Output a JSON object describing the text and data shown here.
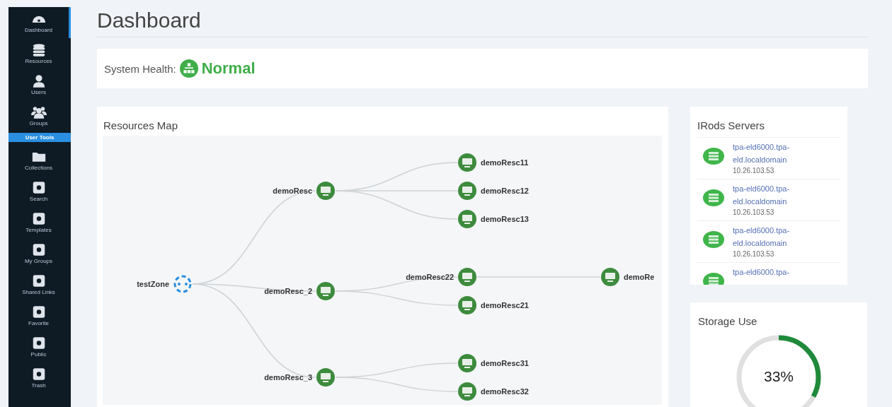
{
  "sidebar": {
    "items": [
      {
        "kind": "item",
        "label": "Dashboard",
        "selected": true
      },
      {
        "kind": "item",
        "label": "Resources",
        "selected": false
      },
      {
        "kind": "item",
        "label": "Users",
        "selected": false
      },
      {
        "kind": "item",
        "label": "Groups",
        "selected": false
      },
      {
        "kind": "section",
        "label": "User Tools"
      },
      {
        "kind": "item",
        "label": "Collections",
        "selected": false
      },
      {
        "kind": "item",
        "label": "Search",
        "selected": false
      },
      {
        "kind": "item",
        "label": "Templates",
        "selected": false
      },
      {
        "kind": "item",
        "label": "My Groups",
        "selected": false
      },
      {
        "kind": "item",
        "label": "Shared Links",
        "selected": false
      },
      {
        "kind": "item",
        "label": "Favorite",
        "selected": false
      },
      {
        "kind": "item",
        "label": "Public",
        "selected": false
      },
      {
        "kind": "item",
        "label": "Trash",
        "selected": false
      }
    ]
  },
  "page_title": "Dashboard",
  "system_health": {
    "label": "System Health:",
    "status": "Normal"
  },
  "resources_map": {
    "title": "Resources Map",
    "root": {
      "name": "testZone",
      "kind": "zone",
      "children": [
        {
          "name": "demoResc",
          "kind": "resource",
          "children": [
            {
              "name": "demoResc11",
              "kind": "resource"
            },
            {
              "name": "demoResc12",
              "kind": "resource"
            },
            {
              "name": "demoResc13",
              "kind": "resource"
            }
          ]
        },
        {
          "name": "demoResc_2",
          "kind": "resource",
          "children": [
            {
              "name": "demoResc22",
              "kind": "resource",
              "children": [
                {
                  "name": "demoRe",
                  "kind": "resource"
                }
              ]
            },
            {
              "name": "demoResc21",
              "kind": "resource"
            }
          ]
        },
        {
          "name": "demoResc_3",
          "kind": "resource",
          "children": [
            {
              "name": "demoResc31",
              "kind": "resource"
            },
            {
              "name": "demoResc32",
              "kind": "resource"
            }
          ]
        }
      ]
    }
  },
  "irods_servers": {
    "title": "IRods Servers",
    "servers": [
      {
        "host": "tpa-eld6000.tpa-eld.localdomain",
        "ip": "10.26.103.53"
      },
      {
        "host": "tpa-eld6000.tpa-eld.localdomain",
        "ip": "10.26.103.53"
      },
      {
        "host": "tpa-eld6000.tpa-eld.localdomain",
        "ip": "10.26.103.53"
      },
      {
        "host": "tpa-eld6000.tpa-"
      }
    ]
  },
  "storage_use": {
    "title": "Storage Use",
    "level": 0.33,
    "reading": "33%"
  }
}
